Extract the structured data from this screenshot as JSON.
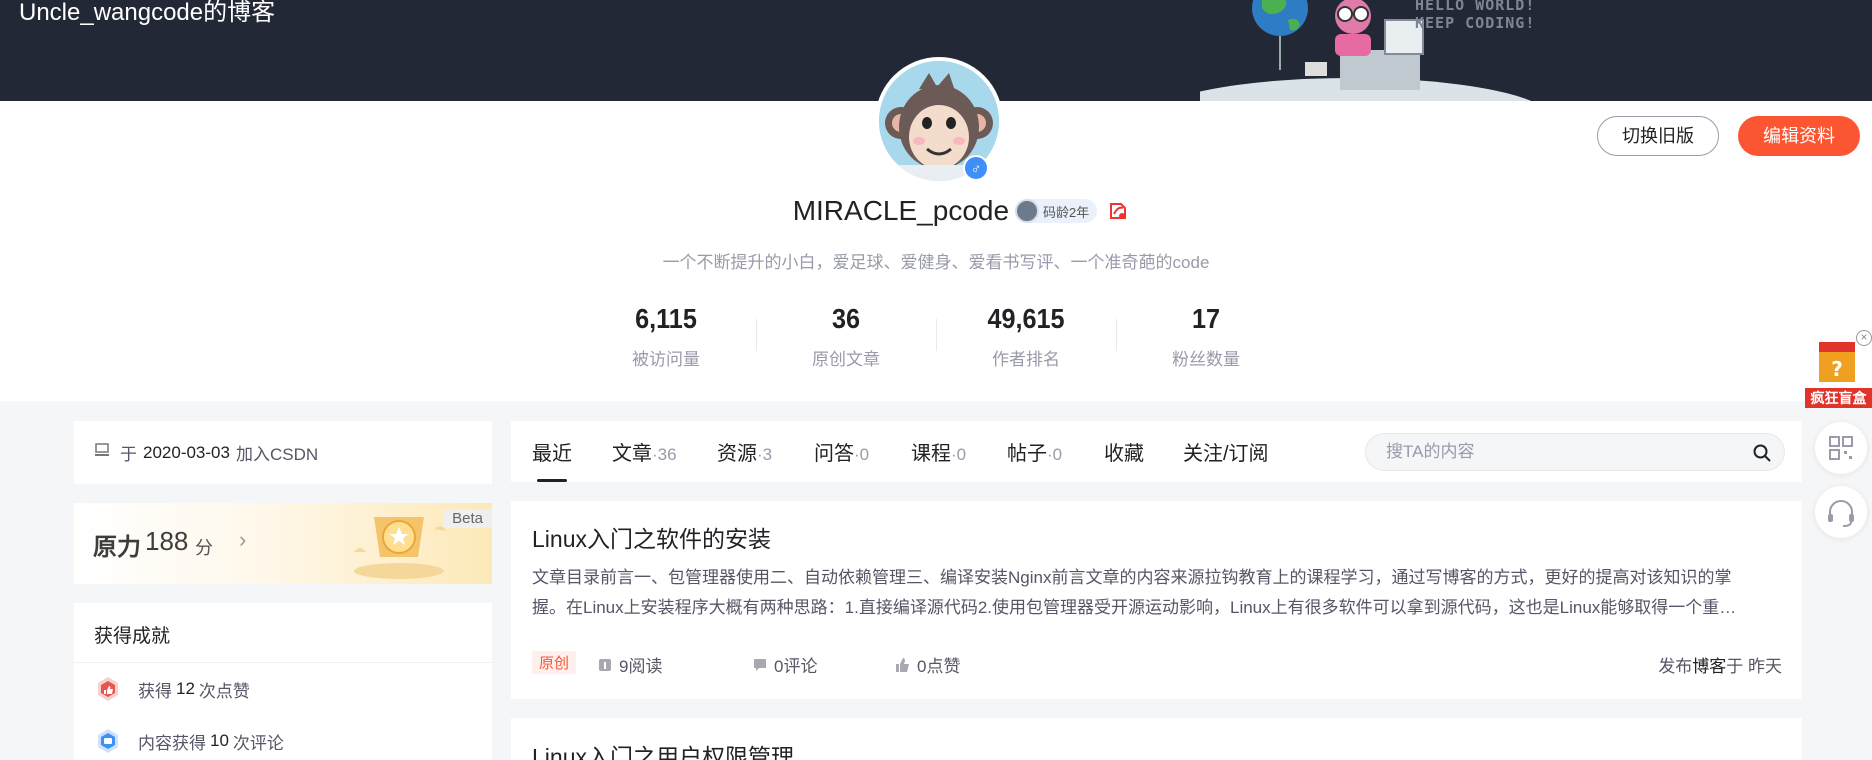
{
  "banner": {
    "title": "Uncle_wangcode的博客",
    "slogan_line1": "HELLO WORLD!",
    "slogan_line2": "KEEP CODING!"
  },
  "profile": {
    "username": "MIRACLE_pcode",
    "code_age": "码龄2年",
    "bio": "一个不断提升的小白，爱足球、爱健身、爱看书写评、一个准奇葩的code",
    "switch_old_label": "切换旧版",
    "edit_label": "编辑资料",
    "stats": [
      {
        "value": "6,115",
        "label": "被访问量"
      },
      {
        "value": "36",
        "label": "原创文章"
      },
      {
        "value": "49,615",
        "label": "作者排名"
      },
      {
        "value": "17",
        "label": "粉丝数量"
      }
    ]
  },
  "sidebar": {
    "join": {
      "prefix": "于",
      "date": "2020-03-03",
      "suffix": "加入CSDN"
    },
    "force": {
      "title": "原力",
      "score": "188",
      "unit": "分",
      "badge": "Beta"
    },
    "achievements": {
      "title": "获得成就",
      "items": [
        {
          "prefix": "获得",
          "count": "12",
          "suffix": "次点赞"
        },
        {
          "prefix": "内容获得",
          "count": "10",
          "suffix": "次评论"
        }
      ]
    }
  },
  "tabs": [
    {
      "label": "最近",
      "count": ""
    },
    {
      "label": "文章",
      "count": "·36"
    },
    {
      "label": "资源",
      "count": "·3"
    },
    {
      "label": "问答",
      "count": "·0"
    },
    {
      "label": "课程",
      "count": "·0"
    },
    {
      "label": "帖子",
      "count": "·0"
    },
    {
      "label": "收藏",
      "count": ""
    },
    {
      "label": "关注/订阅",
      "count": ""
    }
  ],
  "search": {
    "placeholder": "搜TA的内容"
  },
  "articles": [
    {
      "title": "Linux入门之软件的安装",
      "desc_line1": "文章目录前言一、包管理器使用二、自动依赖管理三、编译安装Nginx前言文章的内容来源拉钩教育上的课程学习，通过写博客的方式，更好的提高对该知识的掌",
      "desc_line2": "握。在Linux上安装程序大概有两种思路：1.直接编译源代码2.使用包管理器受开源运动影响，Linux上有很多软件可以拿到源代码，这也是Linux能够取得一个重…",
      "tag": "原创",
      "reads": "9阅读",
      "comments": "0评论",
      "likes": "0点赞",
      "published_prefix": "发布",
      "published_type": "博客",
      "published_suffix": "于 昨天"
    },
    {
      "title": "Linux入门之用户权限管理"
    }
  ],
  "floating": {
    "blindbox_label": "疯狂盲盒"
  },
  "colors": {
    "accent": "#fc5531",
    "banner_bg": "#222836",
    "gender": "#3e8ff7"
  }
}
